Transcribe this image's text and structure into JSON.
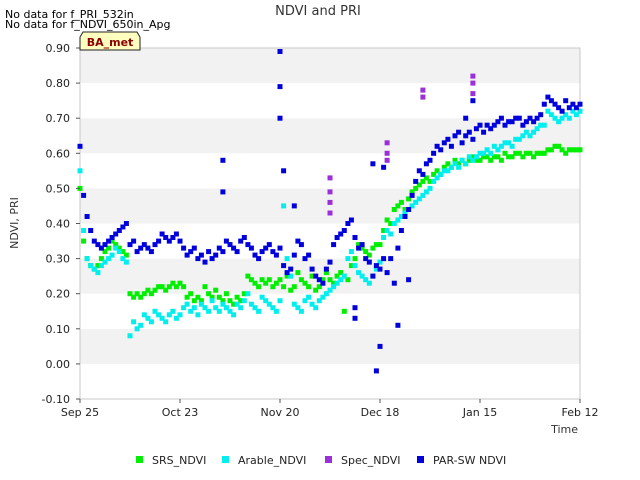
{
  "notes": [
    "No data for f_PRI_532in",
    "No data for f_NDVI_650in_Apg"
  ],
  "badge": "BA_met",
  "chart_data": {
    "type": "scatter",
    "title": "NDVI and PRI",
    "xlabel": "Time",
    "ylabel": "NDVI, PRI",
    "x_axis": {
      "range_days": [
        0,
        140
      ],
      "ticks": [
        {
          "day": 0,
          "label": "Sep 25"
        },
        {
          "day": 28,
          "label": "Oct 23"
        },
        {
          "day": 56,
          "label": "Nov 20"
        },
        {
          "day": 84,
          "label": "Dec 18"
        },
        {
          "day": 112,
          "label": "Jan 15"
        },
        {
          "day": 140,
          "label": "Feb 12"
        }
      ]
    },
    "ylim": [
      -0.1,
      0.9
    ],
    "yticks": [
      "-0.10",
      "0.00",
      "0.10",
      "0.20",
      "0.30",
      "0.40",
      "0.50",
      "0.60",
      "0.70",
      "0.80",
      "0.90"
    ],
    "grid": "horizontal bands",
    "legend_position": "bottom",
    "series": [
      {
        "name": "SRS_NDVI",
        "color": "#00ee00",
        "x": [
          0,
          1,
          2,
          3,
          4,
          5,
          6,
          7,
          8,
          9,
          10,
          11,
          12,
          13,
          14,
          15,
          16,
          17,
          18,
          19,
          20,
          21,
          22,
          23,
          24,
          25,
          26,
          27,
          28,
          29,
          30,
          31,
          32,
          33,
          34,
          35,
          36,
          37,
          38,
          39,
          40,
          41,
          42,
          43,
          44,
          45,
          46,
          47,
          48,
          49,
          50,
          51,
          52,
          53,
          54,
          55,
          56,
          57,
          58,
          59,
          60,
          61,
          62,
          63,
          64,
          65,
          66,
          67,
          68,
          69,
          70,
          71,
          72,
          73,
          74,
          75,
          76,
          77,
          78,
          79,
          80,
          81,
          82,
          83,
          84,
          85,
          86,
          87,
          88,
          89,
          90,
          91,
          92,
          93,
          94,
          95,
          96,
          97,
          98,
          99,
          100,
          101,
          102,
          103,
          104,
          105,
          106,
          107,
          108,
          109,
          110,
          111,
          112,
          113,
          114,
          115,
          116,
          117,
          118,
          119,
          120,
          121,
          122,
          123,
          124,
          125,
          126,
          127,
          128,
          129,
          130,
          131,
          132,
          133,
          134,
          135,
          136,
          137,
          138,
          139,
          140
        ],
        "y": [
          0.5,
          0.35,
          0.3,
          0.28,
          0.27,
          0.28,
          0.3,
          0.32,
          0.33,
          0.35,
          0.34,
          0.33,
          0.32,
          0.31,
          0.2,
          0.19,
          0.2,
          0.19,
          0.2,
          0.21,
          0.2,
          0.21,
          0.22,
          0.22,
          0.21,
          0.22,
          0.23,
          0.22,
          0.23,
          0.22,
          0.19,
          0.2,
          0.18,
          0.19,
          0.18,
          0.22,
          0.2,
          0.19,
          0.21,
          0.19,
          0.18,
          0.2,
          0.18,
          0.17,
          0.19,
          0.18,
          0.2,
          0.25,
          0.24,
          0.23,
          0.22,
          0.24,
          0.23,
          0.24,
          0.22,
          0.23,
          0.24,
          0.22,
          0.25,
          0.21,
          0.22,
          0.26,
          0.24,
          0.23,
          0.22,
          0.25,
          0.21,
          0.22,
          0.24,
          0.26,
          0.24,
          0.23,
          0.25,
          0.26,
          0.15,
          0.24,
          0.28,
          0.3,
          0.34,
          0.33,
          0.32,
          0.31,
          0.33,
          0.34,
          0.34,
          0.38,
          0.41,
          0.4,
          0.44,
          0.45,
          0.46,
          0.44,
          0.47,
          0.49,
          0.5,
          0.51,
          0.52,
          0.53,
          0.52,
          0.54,
          0.55,
          0.54,
          0.56,
          0.57,
          0.56,
          0.58,
          0.57,
          0.58,
          0.57,
          0.58,
          0.59,
          0.58,
          0.58,
          0.59,
          0.59,
          0.58,
          0.59,
          0.59,
          0.58,
          0.6,
          0.59,
          0.59,
          0.6,
          0.6,
          0.59,
          0.6,
          0.6,
          0.59,
          0.6,
          0.6,
          0.6,
          0.61,
          0.61,
          0.62,
          0.62,
          0.61,
          0.6,
          0.61,
          0.61,
          0.61,
          0.61
        ]
      },
      {
        "name": "Arable_NDVI",
        "color": "#00eeee",
        "x": [
          0,
          1,
          2,
          3,
          4,
          5,
          6,
          7,
          8,
          9,
          10,
          11,
          12,
          13,
          14,
          15,
          16,
          17,
          18,
          19,
          20,
          21,
          22,
          23,
          24,
          25,
          26,
          27,
          28,
          29,
          30,
          31,
          32,
          33,
          34,
          35,
          36,
          37,
          38,
          39,
          40,
          41,
          42,
          43,
          44,
          45,
          46,
          47,
          48,
          49,
          50,
          51,
          52,
          53,
          54,
          55,
          56,
          57,
          58,
          59,
          60,
          61,
          62,
          63,
          64,
          65,
          66,
          67,
          68,
          69,
          70,
          71,
          72,
          73,
          74,
          75,
          76,
          77,
          78,
          79,
          80,
          81,
          82,
          83,
          84,
          85,
          86,
          87,
          88,
          89,
          90,
          91,
          92,
          93,
          94,
          95,
          96,
          97,
          98,
          99,
          100,
          101,
          102,
          103,
          104,
          105,
          106,
          107,
          108,
          109,
          110,
          111,
          112,
          113,
          114,
          115,
          116,
          117,
          118,
          119,
          120,
          121,
          122,
          123,
          124,
          125,
          126,
          127,
          128,
          129,
          130,
          131,
          132,
          133,
          134,
          135,
          136,
          137,
          138,
          139,
          140
        ],
        "y": [
          0.55,
          0.38,
          0.3,
          0.28,
          0.27,
          0.26,
          0.28,
          0.29,
          0.3,
          0.31,
          0.33,
          0.32,
          0.3,
          0.29,
          0.08,
          0.12,
          0.1,
          0.11,
          0.14,
          0.13,
          0.12,
          0.15,
          0.14,
          0.13,
          0.12,
          0.14,
          0.15,
          0.13,
          0.14,
          0.16,
          0.17,
          0.15,
          0.16,
          0.14,
          0.17,
          0.16,
          0.15,
          0.18,
          0.16,
          0.15,
          0.17,
          0.16,
          0.15,
          0.14,
          0.17,
          0.16,
          0.18,
          0.2,
          0.17,
          0.16,
          0.15,
          0.19,
          0.18,
          0.17,
          0.16,
          0.15,
          0.18,
          0.45,
          0.3,
          0.25,
          0.17,
          0.16,
          0.15,
          0.18,
          0.19,
          0.17,
          0.16,
          0.18,
          0.19,
          0.2,
          0.21,
          0.22,
          0.23,
          0.24,
          0.25,
          0.3,
          0.32,
          0.28,
          0.26,
          0.25,
          0.24,
          0.23,
          0.25,
          0.27,
          0.29,
          0.36,
          0.38,
          0.37,
          0.4,
          0.41,
          0.42,
          0.43,
          0.44,
          0.45,
          0.46,
          0.47,
          0.48,
          0.49,
          0.5,
          0.52,
          0.53,
          0.54,
          0.55,
          0.55,
          0.56,
          0.57,
          0.56,
          0.58,
          0.57,
          0.59,
          0.58,
          0.59,
          0.6,
          0.6,
          0.61,
          0.6,
          0.62,
          0.61,
          0.62,
          0.63,
          0.63,
          0.62,
          0.64,
          0.64,
          0.65,
          0.66,
          0.65,
          0.66,
          0.67,
          0.68,
          0.68,
          0.72,
          0.71,
          0.7,
          0.69,
          0.7,
          0.71,
          0.7,
          0.72,
          0.71,
          0.72
        ]
      },
      {
        "name": "Spec_NDVI",
        "color": "#9b30d9",
        "x": [
          70,
          70,
          70,
          70,
          86,
          86,
          86,
          96,
          96,
          110,
          110,
          110
        ],
        "y": [
          0.53,
          0.49,
          0.46,
          0.43,
          0.63,
          0.6,
          0.58,
          0.78,
          0.76,
          0.82,
          0.8,
          0.77
        ]
      },
      {
        "name": "PAR-SW NDVI",
        "color": "#0000dd",
        "x": [
          0,
          1,
          2,
          3,
          4,
          5,
          6,
          7,
          8,
          9,
          10,
          11,
          12,
          13,
          14,
          15,
          16,
          17,
          18,
          19,
          20,
          21,
          22,
          23,
          24,
          25,
          26,
          27,
          28,
          29,
          30,
          31,
          32,
          33,
          34,
          35,
          36,
          37,
          38,
          39,
          40,
          41,
          42,
          43,
          44,
          45,
          46,
          47,
          48,
          49,
          50,
          51,
          52,
          53,
          54,
          55,
          56,
          57,
          58,
          59,
          60,
          61,
          62,
          63,
          64,
          65,
          66,
          67,
          68,
          69,
          70,
          71,
          72,
          73,
          74,
          75,
          76,
          77,
          78,
          79,
          80,
          81,
          82,
          83,
          84,
          85,
          86,
          87,
          88,
          89,
          90,
          91,
          92,
          93,
          94,
          95,
          96,
          97,
          98,
          99,
          100,
          101,
          102,
          103,
          104,
          105,
          106,
          107,
          108,
          109,
          110,
          111,
          112,
          113,
          114,
          115,
          116,
          117,
          118,
          119,
          120,
          121,
          122,
          123,
          124,
          125,
          126,
          127,
          128,
          129,
          130,
          131,
          132,
          133,
          134,
          135,
          136,
          137,
          138,
          139,
          140,
          56,
          56,
          56,
          40,
          40,
          77,
          77,
          83,
          84,
          92,
          108,
          110,
          57,
          60,
          82,
          85,
          89
        ],
        "y": [
          0.62,
          0.48,
          0.42,
          0.38,
          0.35,
          0.34,
          0.33,
          0.34,
          0.35,
          0.36,
          0.37,
          0.38,
          0.39,
          0.4,
          0.34,
          0.35,
          0.32,
          0.33,
          0.34,
          0.33,
          0.32,
          0.34,
          0.35,
          0.37,
          0.36,
          0.35,
          0.36,
          0.37,
          0.35,
          0.33,
          0.31,
          0.32,
          0.33,
          0.3,
          0.31,
          0.29,
          0.32,
          0.3,
          0.31,
          0.33,
          0.32,
          0.35,
          0.34,
          0.33,
          0.32,
          0.35,
          0.36,
          0.34,
          0.33,
          0.31,
          0.3,
          0.32,
          0.33,
          0.34,
          0.32,
          0.31,
          0.33,
          0.28,
          0.26,
          0.27,
          0.31,
          0.35,
          0.34,
          0.3,
          0.31,
          0.27,
          0.25,
          0.24,
          0.23,
          0.27,
          0.29,
          0.34,
          0.36,
          0.37,
          0.38,
          0.4,
          0.41,
          0.36,
          0.33,
          0.34,
          0.3,
          0.29,
          0.25,
          0.28,
          0.27,
          0.3,
          0.26,
          0.3,
          0.23,
          0.33,
          0.38,
          0.42,
          0.44,
          0.48,
          0.52,
          0.55,
          0.54,
          0.57,
          0.58,
          0.6,
          0.62,
          0.61,
          0.63,
          0.64,
          0.62,
          0.65,
          0.66,
          0.63,
          0.65,
          0.66,
          0.64,
          0.67,
          0.68,
          0.66,
          0.68,
          0.67,
          0.68,
          0.69,
          0.7,
          0.68,
          0.69,
          0.69,
          0.7,
          0.7,
          0.68,
          0.69,
          0.7,
          0.69,
          0.7,
          0.71,
          0.74,
          0.76,
          0.75,
          0.74,
          0.73,
          0.72,
          0.75,
          0.73,
          0.74,
          0.73,
          0.74,
          0.89,
          0.79,
          0.7,
          0.58,
          0.49,
          0.16,
          0.13,
          -0.02,
          0.05,
          0.24,
          0.7,
          0.75,
          0.55,
          0.45,
          0.57,
          0.56,
          0.11
        ]
      }
    ]
  }
}
